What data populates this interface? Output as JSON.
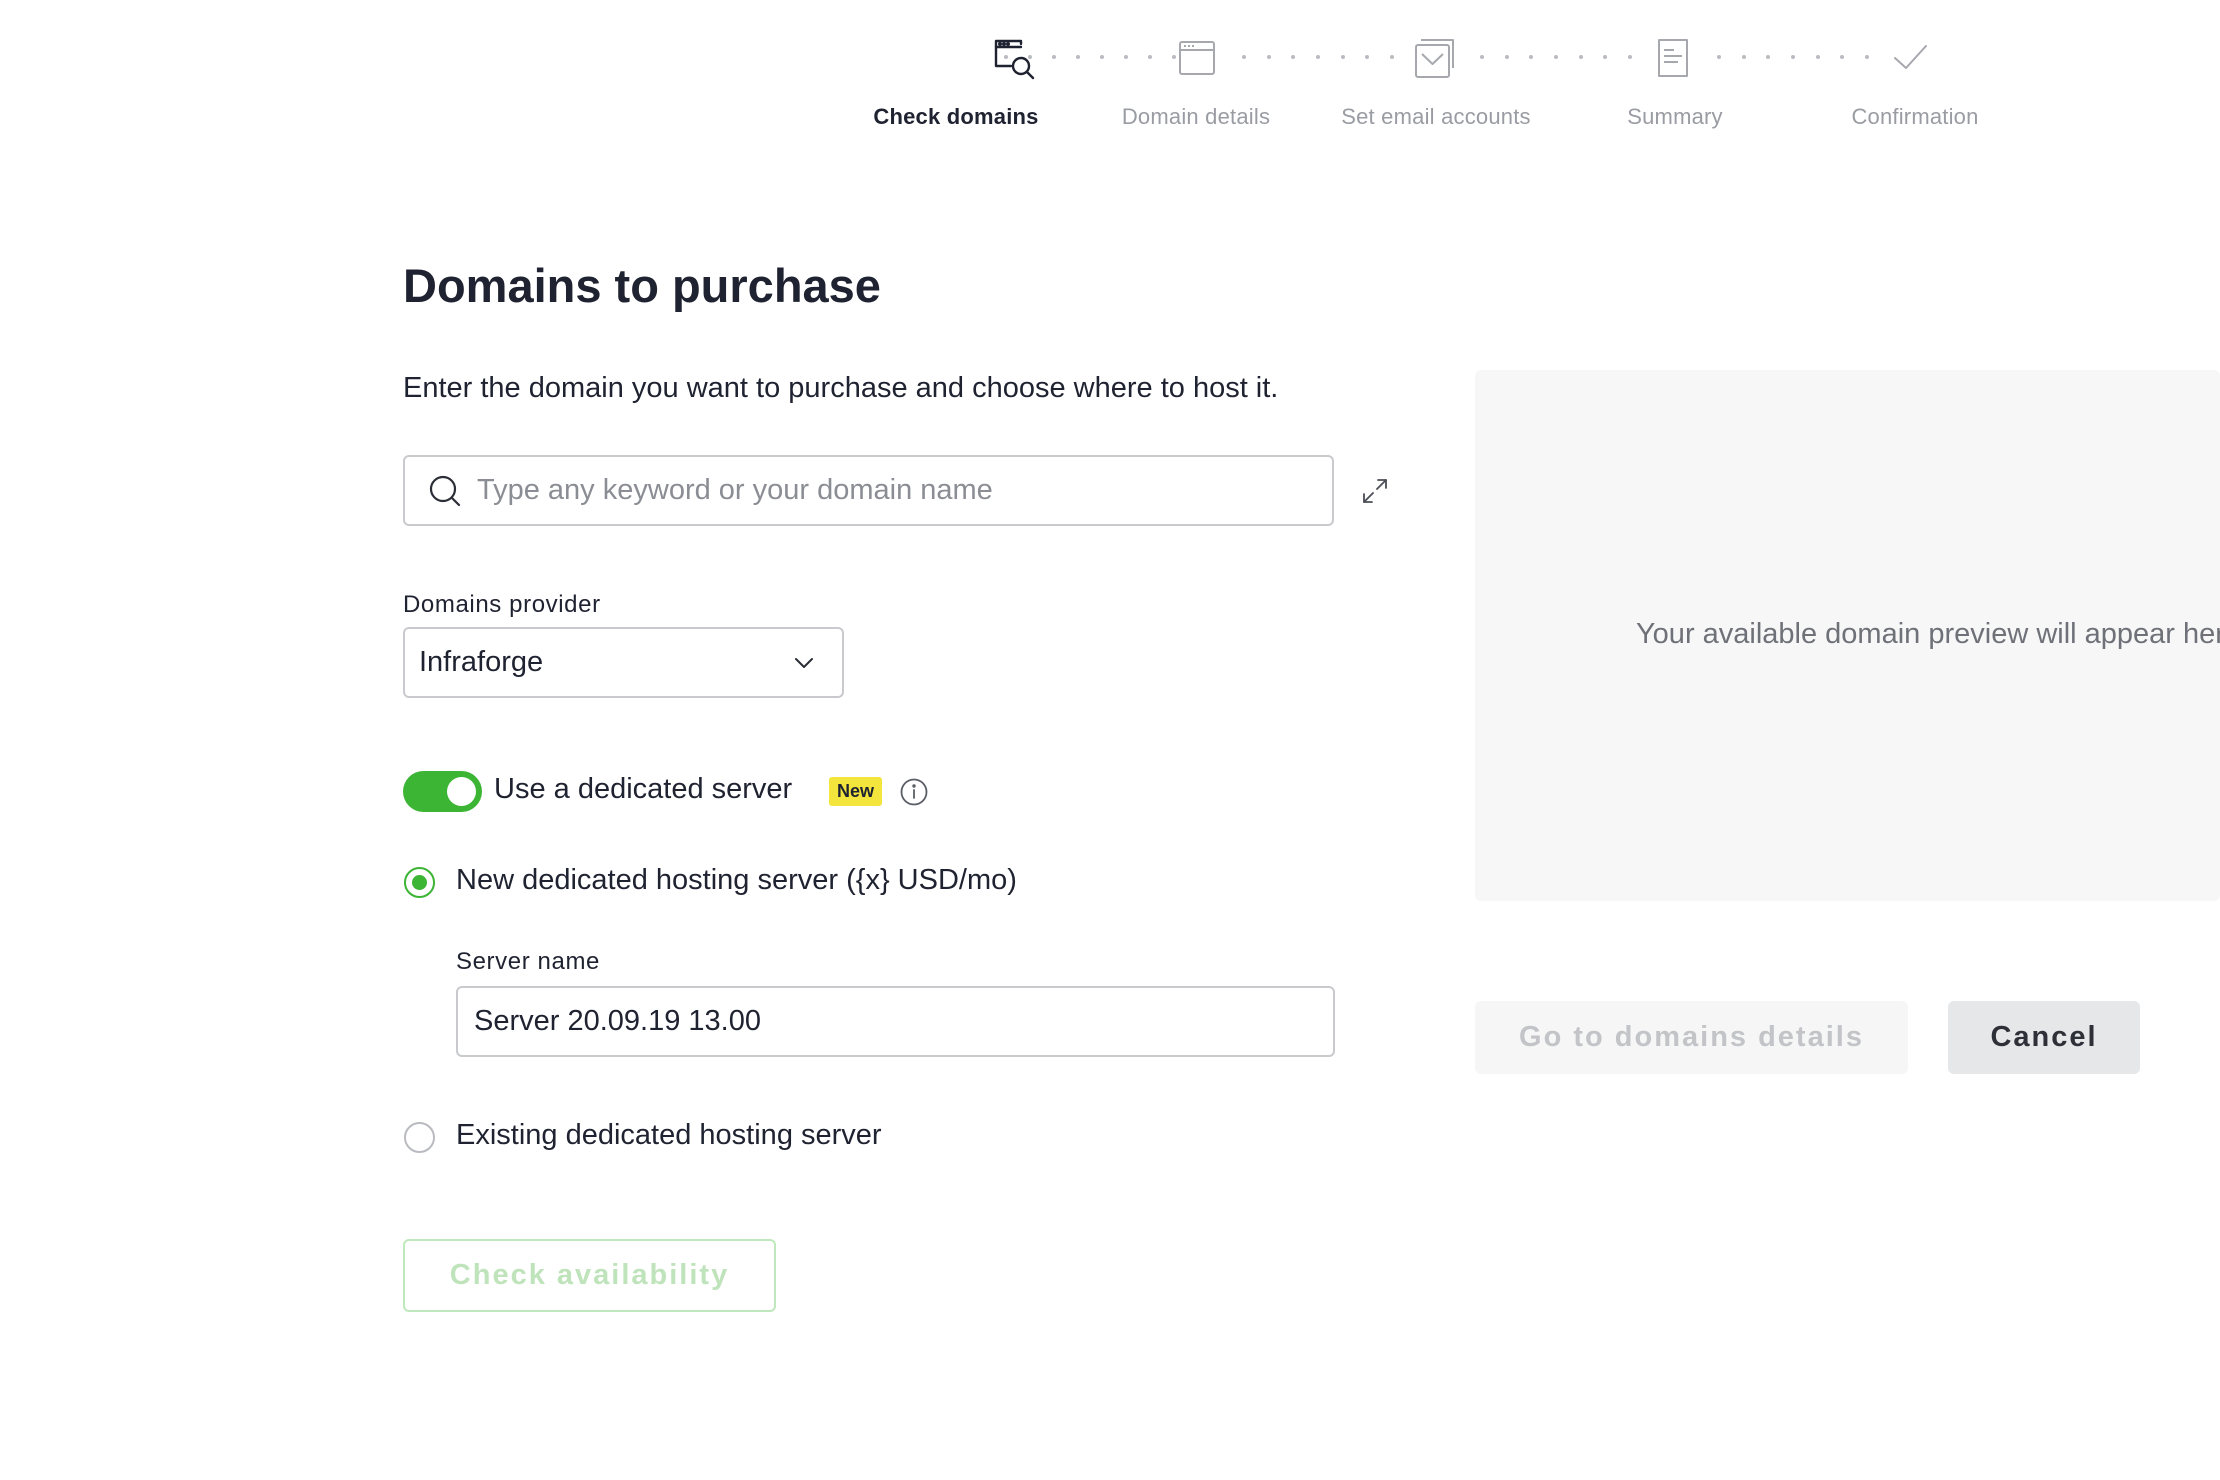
{
  "stepper": {
    "steps": [
      {
        "label": "Check domains",
        "icon": "domain-search-icon",
        "active": true
      },
      {
        "label": "Domain details",
        "icon": "browser-window-icon",
        "active": false
      },
      {
        "label": "Set email accounts",
        "icon": "email-stack-icon",
        "active": false
      },
      {
        "label": "Summary",
        "icon": "document-icon",
        "active": false
      },
      {
        "label": "Confirmation",
        "icon": "checkmark-icon",
        "active": false
      }
    ]
  },
  "main": {
    "title": "Domains to purchase",
    "intro": "Enter the domain you want to purchase and choose where to host it.",
    "search": {
      "placeholder": "Type any keyword or your domain name",
      "value": "",
      "icon": "search-icon"
    },
    "expand_icon": "expand-icon",
    "provider": {
      "label": "Domains provider",
      "value": "Infraforge",
      "icon": "chevron-down-icon"
    },
    "dedicated_server": {
      "toggle_on": true,
      "label": "Use a dedicated server",
      "badge": "New",
      "info_icon": "info-icon"
    },
    "hosting_options": [
      {
        "label": "New dedicated hosting server ({x} USD/mo)",
        "selected": true
      },
      {
        "label": "Existing dedicated hosting server",
        "selected": false
      }
    ],
    "server_name": {
      "label": "Server name",
      "value": "Server 20.09.19 13.00"
    },
    "check_button": "Check availability"
  },
  "preview": {
    "text": "Your available domain preview will appear here"
  },
  "actions": {
    "go_button": "Go to domains details",
    "cancel_button": "Cancel"
  },
  "colors": {
    "accent_green": "#3cb534",
    "badge_yellow": "#f4e53c",
    "text_dark": "#1f2230",
    "text_muted": "#9a9ca3"
  }
}
